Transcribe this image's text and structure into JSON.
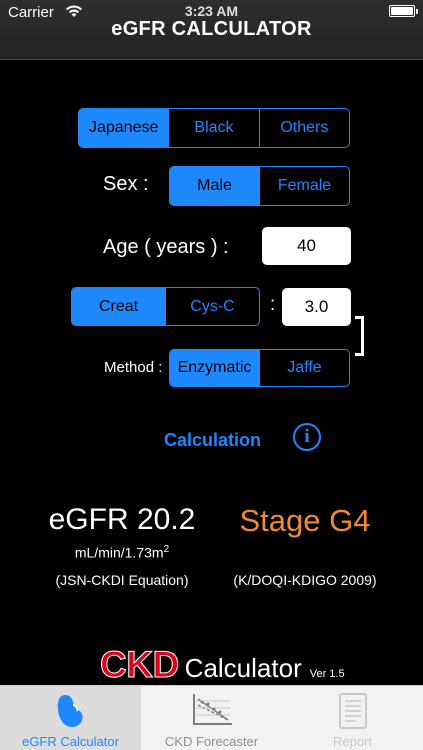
{
  "status": {
    "carrier": "Carrier",
    "time": "3:23 AM"
  },
  "header": {
    "title": "eGFR CALCULATOR"
  },
  "race": {
    "options": [
      "Japanese",
      "Black",
      "Others"
    ],
    "selected": "Japanese"
  },
  "sex": {
    "label": "Sex :",
    "options": [
      "Male",
      "Female"
    ],
    "selected": "Male"
  },
  "age": {
    "label": "Age ( years ) :",
    "value": "40"
  },
  "marker": {
    "options": [
      "Creat",
      "Cys-C"
    ],
    "selected": "Creat",
    "colon": ":",
    "value": "3.0"
  },
  "method": {
    "label": "Method :",
    "options": [
      "Enzymatic",
      "Jaffe"
    ],
    "selected": "Enzymatic"
  },
  "calculate": {
    "label": "Calculation"
  },
  "result": {
    "egfr": "eGFR 20.2",
    "unit": "mL/min/1.73m",
    "unit_sup": "2",
    "equation": "(JSN-CKDI Equation)",
    "stage": "Stage G4",
    "guideline": "(K/DOQI-KDIGO 2009)"
  },
  "brand": {
    "ckd": "CKD",
    "word": "Calculator",
    "version": "Ver 1.5"
  },
  "tabs": [
    {
      "label": "eGFR Calculator",
      "icon": "kidney-icon",
      "state": "active"
    },
    {
      "label": "CKD Forecaster",
      "icon": "chart-icon",
      "state": "normal"
    },
    {
      "label": "Report",
      "icon": "report-icon",
      "state": "disabled"
    }
  ],
  "colors": {
    "accent": "#1e88ff",
    "stage": "#f28a30",
    "brand_red": "#e0001a"
  }
}
